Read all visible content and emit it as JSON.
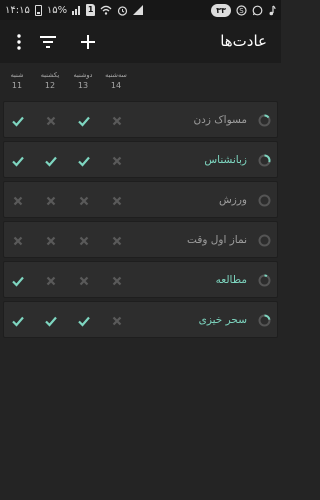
{
  "status_bar": {
    "time": "۱۴:۱۵",
    "battery_percent": "۱۵%",
    "sim": "1",
    "badge": "۳۳"
  },
  "toolbar": {
    "title": "عادت‌ها",
    "add_label": "+"
  },
  "days": [
    {
      "name": "سه‌شنبه",
      "date": "14"
    },
    {
      "name": "دوشنبه",
      "date": "13"
    },
    {
      "name": "یکشنبه",
      "date": "12"
    },
    {
      "name": "شنبه",
      "date": "11"
    }
  ],
  "habits": [
    {
      "name": "مسواک زدن",
      "color": "#9e9e9e",
      "progress": 0.15,
      "checks": [
        false,
        true,
        false,
        true
      ]
    },
    {
      "name": "زبانشناس",
      "color": "#7ed6c0",
      "progress": 0.3,
      "checks": [
        false,
        true,
        true,
        true
      ]
    },
    {
      "name": "ورزش",
      "color": "#9e9e9e",
      "progress": 0,
      "checks": [
        false,
        false,
        false,
        false
      ]
    },
    {
      "name": "نماز اول وقت",
      "color": "#9e9e9e",
      "progress": 0,
      "checks": [
        false,
        false,
        false,
        false
      ]
    },
    {
      "name": "مطالعه",
      "color": "#7ed6c0",
      "progress": 0.08,
      "checks": [
        false,
        false,
        false,
        true
      ]
    },
    {
      "name": "سحر خیزی",
      "color": "#7ed6c0",
      "progress": 0.22,
      "checks": [
        false,
        true,
        true,
        true
      ]
    }
  ],
  "colors": {
    "check": "#7ed6c0",
    "cross": "#5a5a5a",
    "ring_bg": "#555555"
  }
}
